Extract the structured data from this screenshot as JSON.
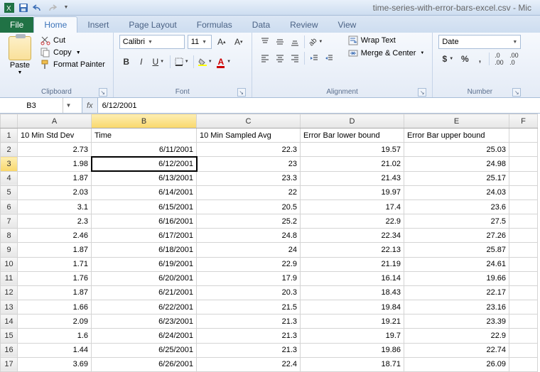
{
  "window_title": "time-series-with-error-bars-excel.csv - Mic",
  "tabs": {
    "file": "File",
    "home": "Home",
    "insert": "Insert",
    "page_layout": "Page Layout",
    "formulas": "Formulas",
    "data": "Data",
    "review": "Review",
    "view": "View"
  },
  "clipboard": {
    "paste": "Paste",
    "cut": "Cut",
    "copy": "Copy",
    "format_painter": "Format Painter",
    "group_label": "Clipboard"
  },
  "font": {
    "name": "Calibri",
    "size": "11",
    "group_label": "Font"
  },
  "alignment": {
    "wrap_text": "Wrap Text",
    "merge_center": "Merge & Center",
    "group_label": "Alignment"
  },
  "number": {
    "format": "Date",
    "group_label": "Number"
  },
  "namebox": "B3",
  "formula": "6/12/2001",
  "columns": [
    "A",
    "B",
    "C",
    "D",
    "E",
    "F"
  ],
  "active_col_index": 1,
  "active_row_index": 2,
  "selected_cell": {
    "row": 2,
    "col": 1
  },
  "headers": [
    "10 Min Std Dev",
    "Time",
    "10 Min Sampled Avg",
    "Error Bar lower bound",
    "Error Bar upper bound",
    ""
  ],
  "rows": [
    [
      "2.73",
      "6/11/2001",
      "22.3",
      "19.57",
      "25.03",
      ""
    ],
    [
      "1.98",
      "6/12/2001",
      "23",
      "21.02",
      "24.98",
      ""
    ],
    [
      "1.87",
      "6/13/2001",
      "23.3",
      "21.43",
      "25.17",
      ""
    ],
    [
      "2.03",
      "6/14/2001",
      "22",
      "19.97",
      "24.03",
      ""
    ],
    [
      "3.1",
      "6/15/2001",
      "20.5",
      "17.4",
      "23.6",
      ""
    ],
    [
      "2.3",
      "6/16/2001",
      "25.2",
      "22.9",
      "27.5",
      ""
    ],
    [
      "2.46",
      "6/17/2001",
      "24.8",
      "22.34",
      "27.26",
      ""
    ],
    [
      "1.87",
      "6/18/2001",
      "24",
      "22.13",
      "25.87",
      ""
    ],
    [
      "1.71",
      "6/19/2001",
      "22.9",
      "21.19",
      "24.61",
      ""
    ],
    [
      "1.76",
      "6/20/2001",
      "17.9",
      "16.14",
      "19.66",
      ""
    ],
    [
      "1.87",
      "6/21/2001",
      "20.3",
      "18.43",
      "22.17",
      ""
    ],
    [
      "1.66",
      "6/22/2001",
      "21.5",
      "19.84",
      "23.16",
      ""
    ],
    [
      "2.09",
      "6/23/2001",
      "21.3",
      "19.21",
      "23.39",
      ""
    ],
    [
      "1.6",
      "6/24/2001",
      "21.3",
      "19.7",
      "22.9",
      ""
    ],
    [
      "1.44",
      "6/25/2001",
      "21.3",
      "19.86",
      "22.74",
      ""
    ],
    [
      "3.69",
      "6/26/2001",
      "22.4",
      "18.71",
      "26.09",
      ""
    ]
  ]
}
